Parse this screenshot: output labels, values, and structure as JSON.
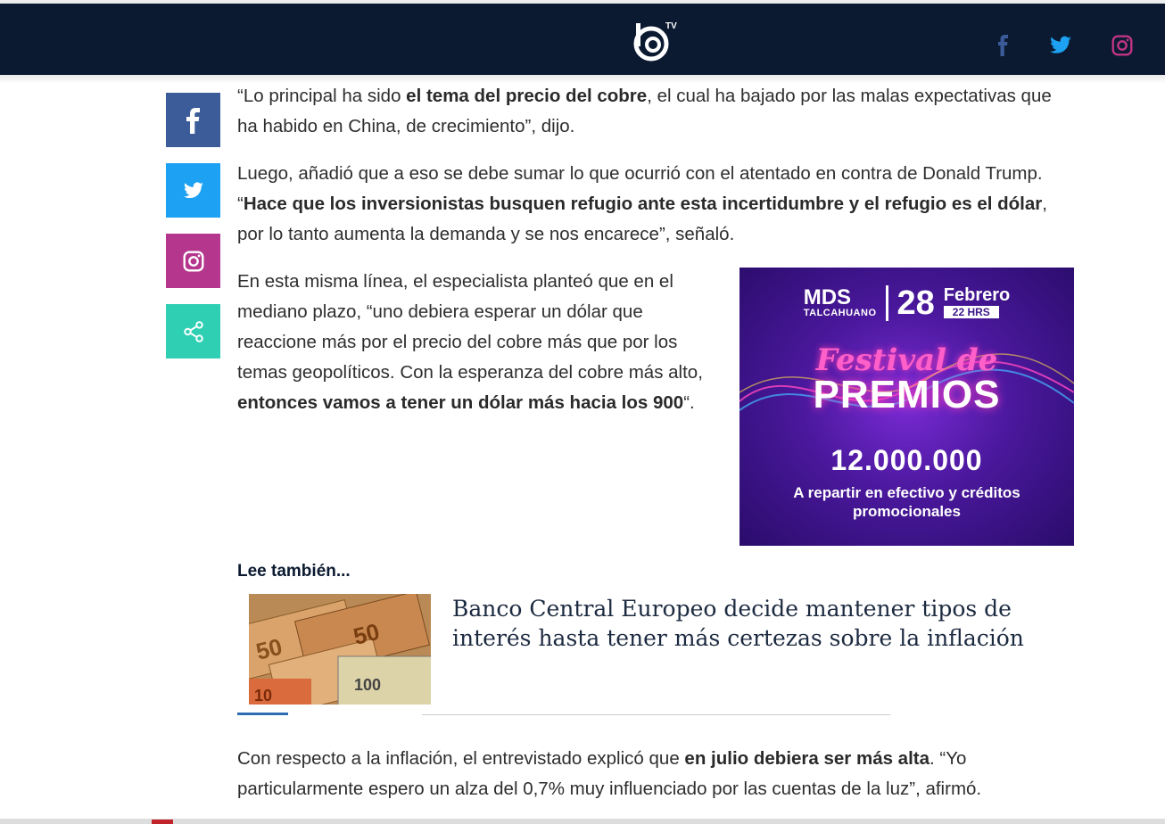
{
  "header": {
    "logo_alt": "TV",
    "social": [
      "facebook-icon",
      "twitter-icon",
      "instagram-icon"
    ],
    "colors": {
      "background": "#0b1a30",
      "facebook": "#3b5b99",
      "twitter": "#1da1f2",
      "instagram": "#c13584"
    }
  },
  "share": {
    "items": [
      "facebook-icon",
      "twitter-icon",
      "instagram-icon",
      "share-icon"
    ],
    "colors": {
      "facebook": "#3b5b99",
      "twitter": "#1da1f2",
      "instagram": "#b5378d",
      "share": "#2fcfb3"
    }
  },
  "article": {
    "p1": {
      "a": "“Lo principal ha sido ",
      "b": "el tema del precio del cobre",
      "c": ", el cual ha bajado por las malas expectativas que ha habido en China, de crecimiento”, dijo."
    },
    "p2": {
      "a": "Luego, añadió que a eso se debe sumar lo que ocurrió con el atentado en contra de Donald Trump. “",
      "b": "Hace que los inversionistas busquen refugio ante esta incertidumbre y el refugio es el dólar",
      "c": ", por lo tanto aumenta la demanda y se nos encarece”, señaló."
    },
    "p3": {
      "a": "En esta misma línea, el especialista planteó que en el mediano plazo, “uno debiera esperar un dólar que reaccione más por el precio del cobre más que por los temas geopolíticos. Con la esperanza del cobre más alto, ",
      "b": "entonces vamos a tener un dólar más hacia los 900",
      "c": "“."
    },
    "p4": {
      "a": "Con respecto a la inflación, el entrevistado explicó que ",
      "b": "en julio debiera ser más alta",
      "c": ". “Yo particularmente espero un alza del 0,7% muy influenciado por las cuentas de la luz”, afirmó."
    }
  },
  "ad": {
    "brand": "MDS",
    "brand_sub": "TALCAHUANO",
    "day": "28",
    "month": "Febrero",
    "hours": "22 HRS",
    "festival": "Festival de",
    "premios": "PREMIOS",
    "amount": "12.000.000",
    "subtitle_1": "A repartir en efectivo y créditos",
    "subtitle_2": "promocionales"
  },
  "related": {
    "heading": "Lee también...",
    "title": "Banco Central Europeo decide mantener tipos de interés hasta tener más certezas sobre la inflación",
    "image": "euro-banknotes-image"
  }
}
